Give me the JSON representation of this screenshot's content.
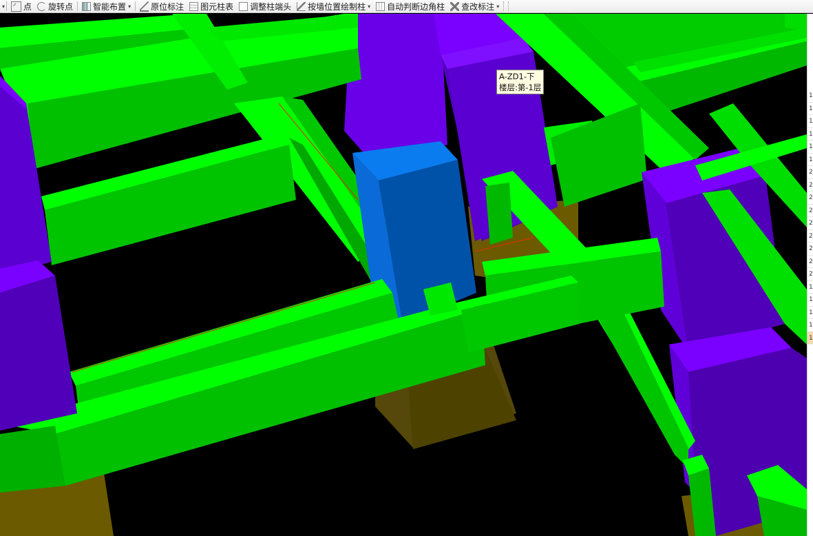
{
  "toolbar": {
    "items": [
      {
        "label": "点",
        "icon": "point-icon"
      },
      {
        "label": "旋转点",
        "icon": "rotate-point-icon"
      },
      {
        "label": "智能布置",
        "icon": "smart-layout-icon",
        "dropdown": true
      },
      {
        "label": "原位标注",
        "icon": "in-place-mark-icon"
      },
      {
        "label": "图元柱表",
        "icon": "column-table-icon"
      },
      {
        "label": "调整柱端头",
        "icon": "adjust-column-end-icon"
      },
      {
        "label": "按墙位置绘制柱",
        "icon": "wall-position-column-icon",
        "dropdown": true
      },
      {
        "label": "自动判断边角柱",
        "icon": "auto-corner-column-icon"
      },
      {
        "label": "查改标注",
        "icon": "check-edit-mark-icon",
        "dropdown": true
      }
    ]
  },
  "tooltip": {
    "line1": "A-ZD1-下",
    "line2": "楼层:第-1层"
  },
  "side_strip": {
    "rows": [
      "1",
      "1",
      "1",
      "1",
      "1",
      "1",
      "2",
      "2",
      "2",
      "2",
      "2",
      "2",
      "2",
      "2",
      "2",
      "1",
      "1",
      "1",
      "1",
      "1"
    ]
  },
  "colors": {
    "beam_top": "#00ff00",
    "beam_side": "#00cc00",
    "beam_dark": "#00a800",
    "column_purple_light": "#7a00ff",
    "column_purple_dark": "#5200c0",
    "column_blue_light": "#0a7cf0",
    "column_blue_dark": "#0052a8",
    "footing_olive": "#6b5a00",
    "footing_dark": "#4f4400",
    "background": "#000000"
  }
}
